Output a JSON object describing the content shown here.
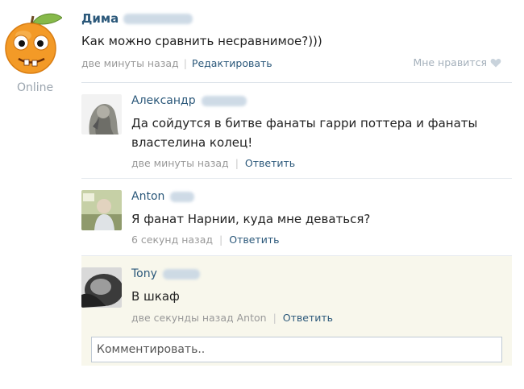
{
  "post": {
    "author_first": "Дима",
    "text": "Как можно сравнить несравнимое?)))",
    "time": "две минуты назад",
    "edit_label": "Редактировать",
    "like_label": "Мне нравится",
    "online": "Online"
  },
  "replies": [
    {
      "author_first": "Александр",
      "text": "Да сойдутся в битве фанаты гарри поттера и фанаты властелина колец!",
      "time": "две минуты назад",
      "reply_label": "Ответить"
    },
    {
      "author_first": "Anton",
      "text": "Я фанат Нарнии, куда мне деваться?",
      "time": "6 секунд назад",
      "reply_label": "Ответить"
    },
    {
      "author_first": "Tony",
      "text": "В шкаф",
      "time": "две секунды назад",
      "addressee": "Anton",
      "reply_label": "Ответить"
    }
  ],
  "comment_box": {
    "placeholder": "Комментировать.."
  },
  "colors": {
    "link": "#2b587a",
    "meta": "#999999",
    "highlight": "#f8f7ec"
  }
}
